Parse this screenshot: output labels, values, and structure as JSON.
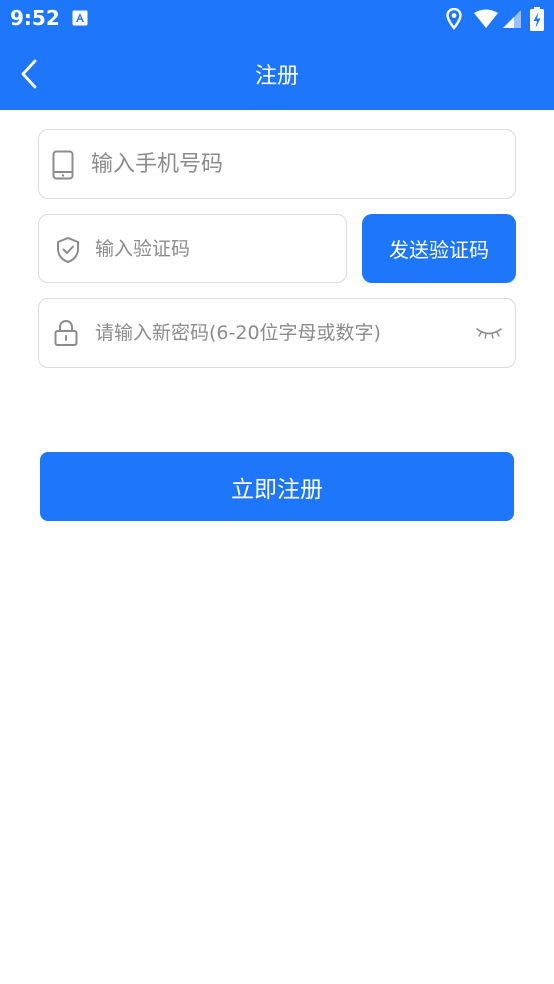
{
  "status_bar": {
    "time": "9:52"
  },
  "header": {
    "title": "注册",
    "back_icon": "chevron-left-icon"
  },
  "form": {
    "phone": {
      "placeholder": "输入手机号码",
      "value": "",
      "icon": "phone-icon"
    },
    "code": {
      "placeholder": "输入验证码",
      "value": "",
      "icon": "shield-check-icon"
    },
    "send_code_label": "发送验证码",
    "password": {
      "placeholder": "请输入新密码(6-20位字母或数字)",
      "value": "",
      "icon": "lock-icon",
      "toggle_icon": "eye-closed-icon"
    },
    "submit_label": "立即注册"
  },
  "colors": {
    "primary": "#1e76fb",
    "border": "#dcdcdc",
    "placeholder": "#8c8c8c"
  }
}
